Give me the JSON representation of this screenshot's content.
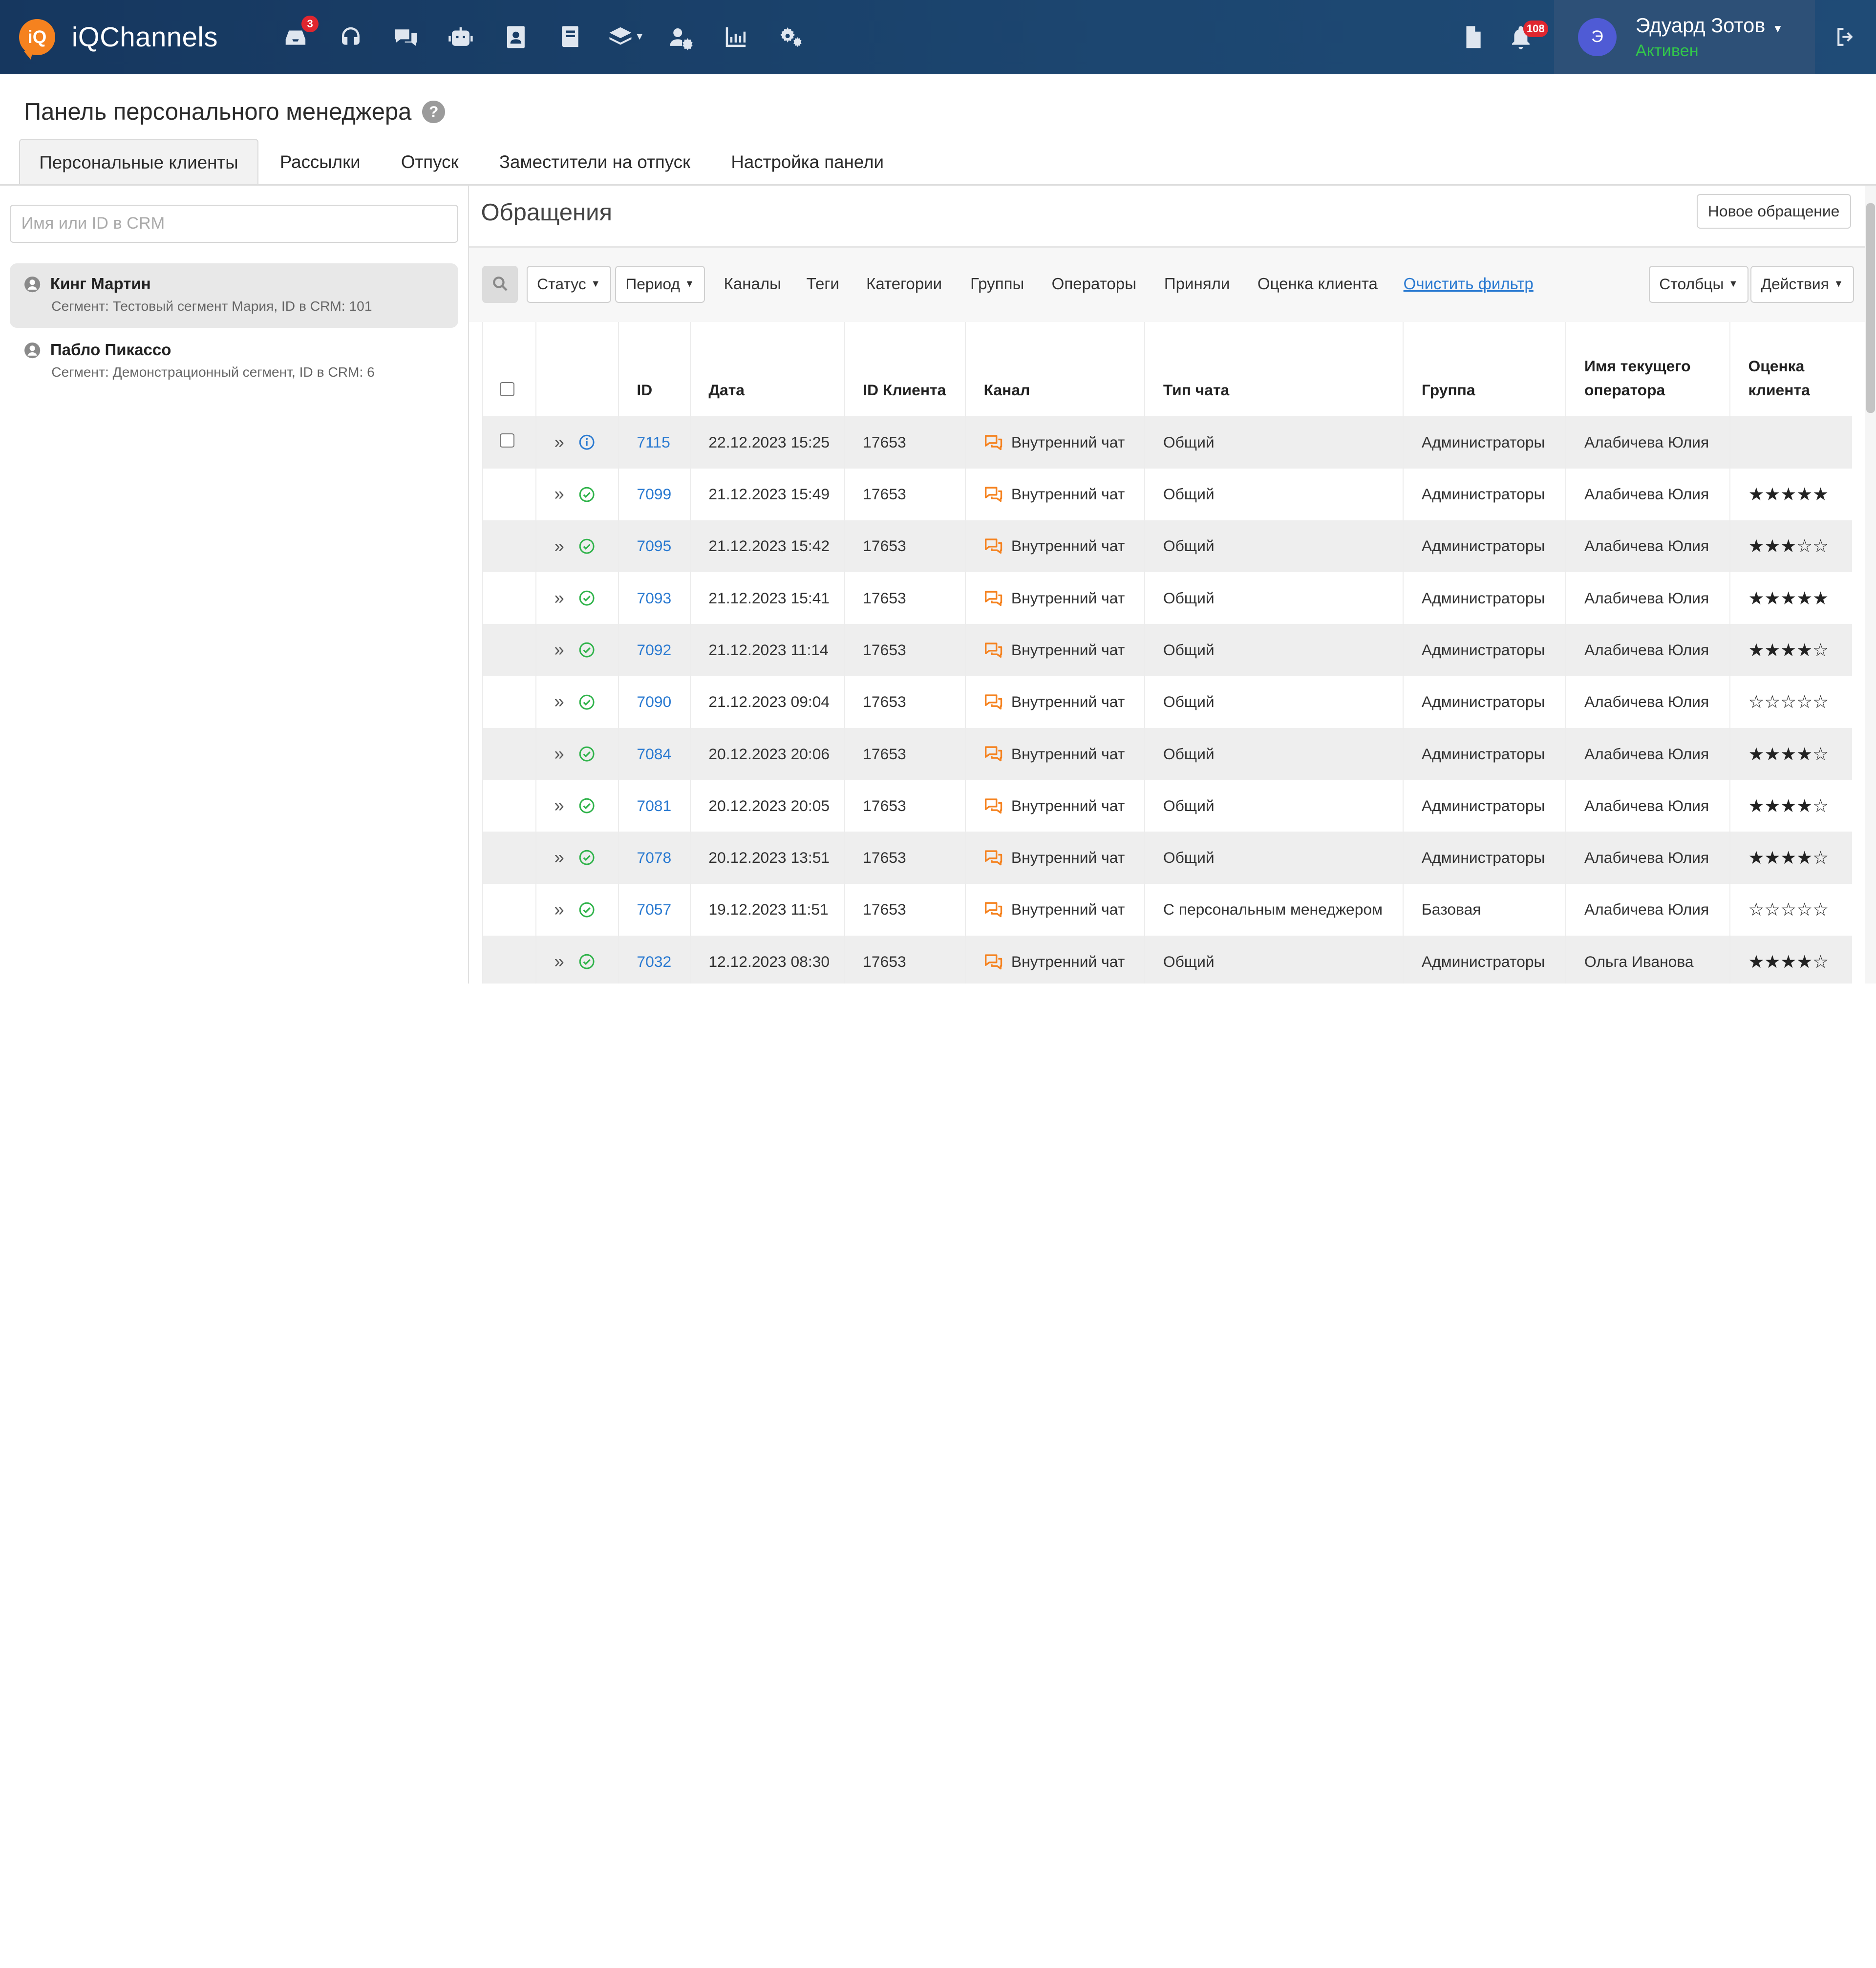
{
  "app": {
    "name": "iQChannels"
  },
  "topbar": {
    "inbox_badge": "3",
    "notify_badge": "108",
    "user_initial": "Э",
    "user_name": "Эдуард Зотов",
    "user_status": "Активен",
    "nav_icons": [
      "inbox-icon",
      "headset-icon",
      "chats-icon",
      "bot-icon",
      "contacts-icon",
      "book-icon",
      "layers-icon",
      "users-gear-icon",
      "analytics-icon",
      "settings-icon"
    ]
  },
  "page": {
    "title": "Панель персонального менеджера",
    "help": "?",
    "tabs": [
      "Персональные клиенты",
      "Рассылки",
      "Отпуск",
      "Заместители на отпуск",
      "Настройка панели"
    ]
  },
  "left": {
    "search_placeholder": "Имя или ID в CRM",
    "clients": [
      {
        "name": "Кинг Мартин",
        "sub": "Сегмент: Тестовый сегмент Мария, ID в CRM: 101"
      },
      {
        "name": "Пабло Пикассо",
        "sub": "Сегмент: Демонстрационный сегмент, ID в CRM: 6"
      }
    ]
  },
  "main": {
    "title": "Обращения",
    "new_button": "Новое обращение",
    "filters": {
      "status": "Статус",
      "period": "Период",
      "channels": "Каналы",
      "tags": "Теги",
      "categories": "Категории",
      "groups": "Группы",
      "operators": "Операторы",
      "accepted": "Приняли",
      "rating": "Оценка клиента",
      "clear": "Очистить фильтр",
      "columns": "Столбцы",
      "actions": "Действия"
    },
    "table": {
      "headers": [
        "ID",
        "Дата",
        "ID Клиента",
        "Канал",
        "Тип чата",
        "Группа",
        "Имя текущего оператора",
        "Оценка клиента"
      ],
      "rows": [
        {
          "status": "info",
          "id": "7115",
          "date": "22.12.2023 15:25",
          "client": "17653",
          "channel": "Внутренний чат",
          "type": "Общий",
          "group": "Администраторы",
          "operator": "Алабичева Юлия",
          "rating": null
        },
        {
          "status": "ok",
          "id": "7099",
          "date": "21.12.2023 15:49",
          "client": "17653",
          "channel": "Внутренний чат",
          "type": "Общий",
          "group": "Администраторы",
          "operator": "Алабичева Юлия",
          "rating": 5
        },
        {
          "status": "ok",
          "id": "7095",
          "date": "21.12.2023 15:42",
          "client": "17653",
          "channel": "Внутренний чат",
          "type": "Общий",
          "group": "Администраторы",
          "operator": "Алабичева Юлия",
          "rating": 3
        },
        {
          "status": "ok",
          "id": "7093",
          "date": "21.12.2023 15:41",
          "client": "17653",
          "channel": "Внутренний чат",
          "type": "Общий",
          "group": "Администраторы",
          "operator": "Алабичева Юлия",
          "rating": 5
        },
        {
          "status": "ok",
          "id": "7092",
          "date": "21.12.2023 11:14",
          "client": "17653",
          "channel": "Внутренний чат",
          "type": "Общий",
          "group": "Администраторы",
          "operator": "Алабичева Юлия",
          "rating": 4
        },
        {
          "status": "ok",
          "id": "7090",
          "date": "21.12.2023 09:04",
          "client": "17653",
          "channel": "Внутренний чат",
          "type": "Общий",
          "group": "Администраторы",
          "operator": "Алабичева Юлия",
          "rating": 0
        },
        {
          "status": "ok",
          "id": "7084",
          "date": "20.12.2023 20:06",
          "client": "17653",
          "channel": "Внутренний чат",
          "type": "Общий",
          "group": "Администраторы",
          "operator": "Алабичева Юлия",
          "rating": 4
        },
        {
          "status": "ok",
          "id": "7081",
          "date": "20.12.2023 20:05",
          "client": "17653",
          "channel": "Внутренний чат",
          "type": "Общий",
          "group": "Администраторы",
          "operator": "Алабичева Юлия",
          "rating": 4
        },
        {
          "status": "ok",
          "id": "7078",
          "date": "20.12.2023 13:51",
          "client": "17653",
          "channel": "Внутренний чат",
          "type": "Общий",
          "group": "Администраторы",
          "operator": "Алабичева Юлия",
          "rating": 4
        },
        {
          "status": "ok",
          "id": "7057",
          "date": "19.12.2023 11:51",
          "client": "17653",
          "channel": "Внутренний чат",
          "type": "С персональным менеджером",
          "group": "Базовая",
          "operator": "Алабичева Юлия",
          "rating": 0
        },
        {
          "status": "ok",
          "id": "7032",
          "date": "12.12.2023 08:30",
          "client": "17653",
          "channel": "Внутренний чат",
          "type": "Общий",
          "group": "Администраторы",
          "operator": "Ольга Иванова",
          "rating": 4
        }
      ]
    }
  },
  "colors": {
    "accent": "#2a7ad1",
    "brand_orange": "#f5821f",
    "status_ok": "#2fb34a",
    "status_active": "#32c84a",
    "topbar": "#1c4670"
  }
}
